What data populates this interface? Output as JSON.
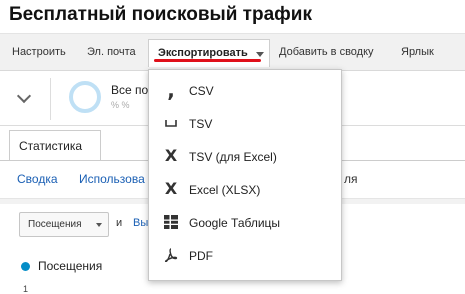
{
  "page": {
    "title": "Бесплатный поисковый трафик"
  },
  "toolbar": {
    "items": [
      "Настроить",
      "Эл. почта"
    ],
    "export_label": "Экспортировать",
    "add_label": "Добавить в сводку",
    "shortcut_label": "Ярлык"
  },
  "summary": {
    "label": "Все по",
    "sub": "% %"
  },
  "tabs": {
    "stats": "Статистика"
  },
  "subnav": {
    "summary": "Сводка",
    "usage": "Использова",
    "tail": "ля"
  },
  "controls": {
    "metric_select": "Посещения",
    "and_text": "и",
    "compare_link": "Вы"
  },
  "legend": {
    "label": "Посещения",
    "y_tick": "1"
  },
  "export_menu": {
    "items": [
      {
        "icon": "csv-comma-icon",
        "label": "CSV"
      },
      {
        "icon": "tsv-space-icon",
        "label": "TSV"
      },
      {
        "icon": "excel-x-icon",
        "label": "TSV (для Excel)"
      },
      {
        "icon": "excel-x-icon",
        "label": "Excel (XLSX)"
      },
      {
        "icon": "google-sheets-icon",
        "label": "Google Таблицы"
      },
      {
        "icon": "pdf-icon",
        "label": "PDF"
      }
    ]
  },
  "colors": {
    "accent_underline": "#e0101a",
    "link": "#1a5fb4",
    "series": "#058dc7"
  }
}
